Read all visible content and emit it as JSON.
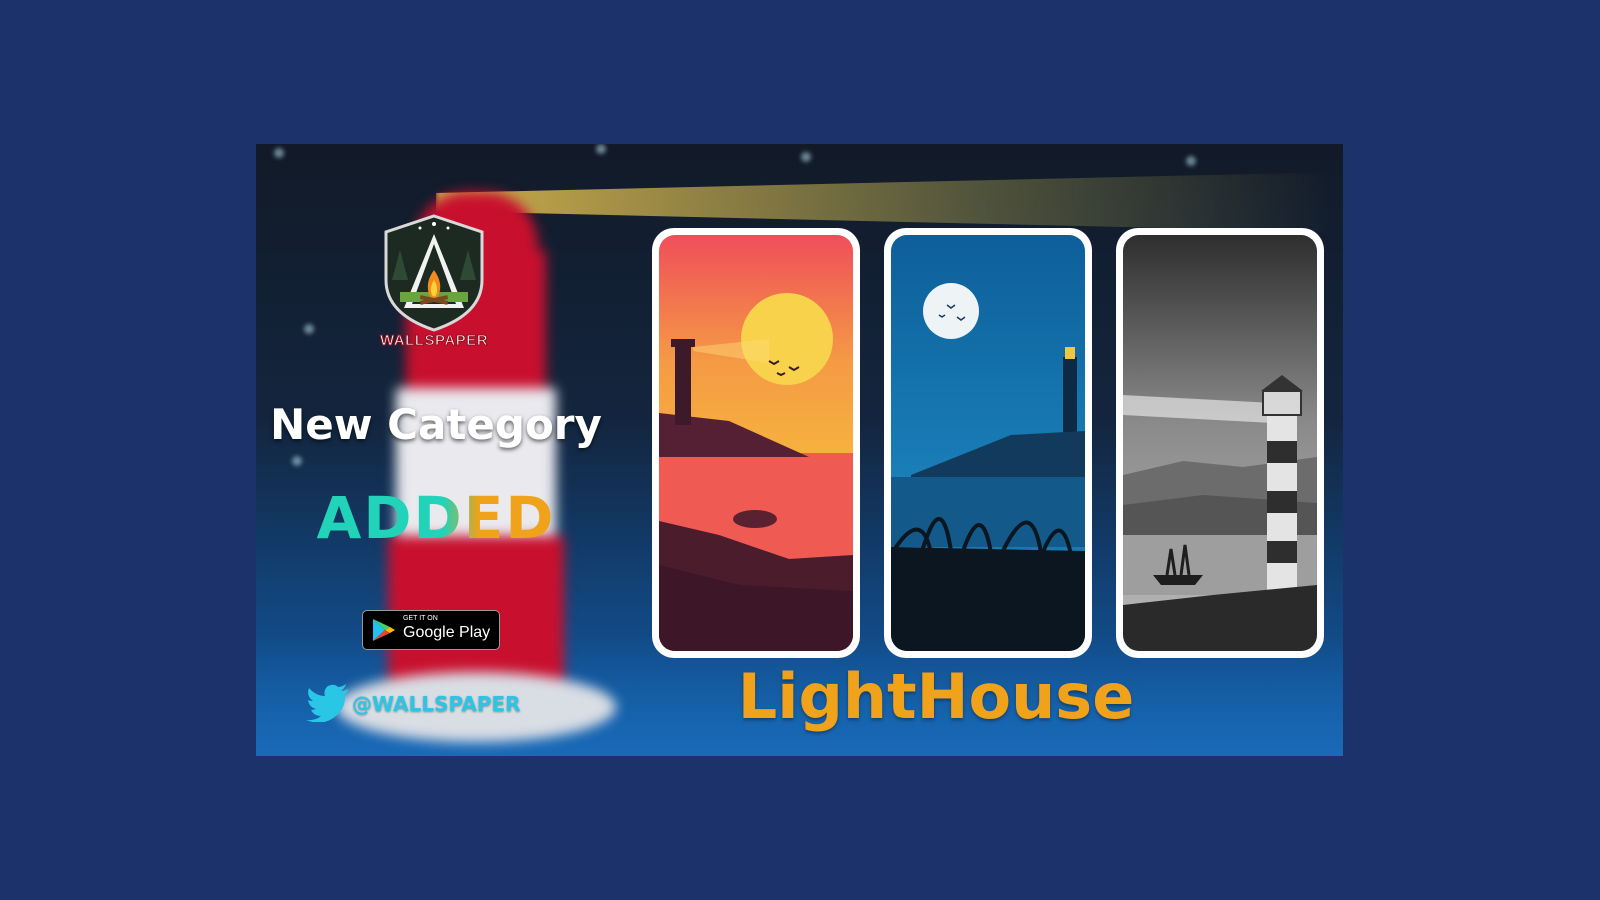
{
  "brand": {
    "logo_text": "WALLSPAPER"
  },
  "promo": {
    "headline": "New Category",
    "added_label": "ADDED",
    "category_title": "LightHouse"
  },
  "store_badge": {
    "small_text": "GET IT ON",
    "store_name": "Google Play"
  },
  "social": {
    "icon": "twitter-bird-icon",
    "handle": "@WALLSPAPER"
  },
  "wallpapers": [
    {
      "name": "sunset-lighthouse",
      "theme": "orange sunset"
    },
    {
      "name": "moonlit-lighthouse",
      "theme": "blue night"
    },
    {
      "name": "monochrome-lighthouse",
      "theme": "grayscale"
    }
  ],
  "colors": {
    "background": "#1b336a",
    "accent_orange": "#f0a21a",
    "accent_teal": "#21d3b8",
    "twitter_blue": "#29c6e6"
  }
}
